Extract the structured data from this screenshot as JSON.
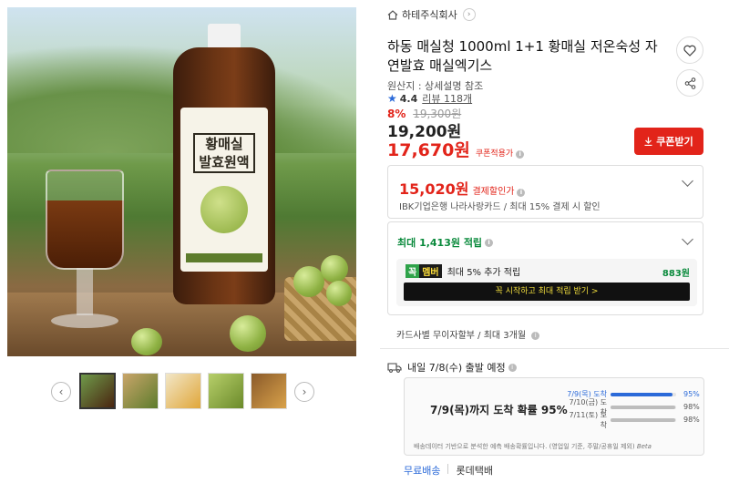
{
  "seller": {
    "name": "하테주식회사"
  },
  "product": {
    "title": "하동 매실청 1000ml 1+1 황매실 저온숙성 자연발효 매실엑기스",
    "origin": "원산지 : 상세설명 참조",
    "rating": "4.4",
    "reviews": "리뷰 118개",
    "discount_rate": "8%",
    "original_price": "19,300원",
    "price": "19,200원",
    "coupon_price": "17,670원",
    "coupon_price_tag": "쿠폰적용가",
    "coupon_button": "쿠폰받기"
  },
  "payment_discount": {
    "amount": "15,020원",
    "label": "결제할인가",
    "desc": "IBK기업은행 나라사랑카드 / 최대 15% 결제 시 할인"
  },
  "points": {
    "label": "최대 1,413원 적립",
    "member_badge_1": "꼭",
    "member_badge_2": "멤버",
    "member_text": "최대 5% 추가 적립",
    "member_points": "883원",
    "member_button": "꼭 시작하고 최대 적립 받기  >"
  },
  "card_installment": "카드사별 무이자할부 / 최대 3개월",
  "delivery": {
    "schedule": "내일 7/8(수) 출발 예정",
    "headline": "7/9(목)까지 도착 확률 95%",
    "rows": [
      {
        "date": "7/9(목) 도착",
        "percent": "95%",
        "value": 0.95
      },
      {
        "date": "7/10(금) 도착",
        "percent": "98%",
        "value": 0.98
      },
      {
        "date": "7/11(토) 도착",
        "percent": "98%",
        "value": 0.98
      }
    ],
    "note": "배송데이터 기반으로 분석한 예측 배송확률입니다. (영업일 기준, 주말/공휴일 제외)",
    "beta": "Beta",
    "free_shipping": "무료배송",
    "carrier": "롯데택배"
  },
  "bottle_label": {
    "line1": "황매실",
    "line2": "발효원액"
  },
  "icons": [
    "home-icon",
    "heart-icon",
    "share-icon",
    "chevron-left-icon",
    "chevron-right-icon",
    "truck-icon",
    "chevron-down-icon",
    "info-icon",
    "download-icon",
    "star-icon"
  ],
  "colors": {
    "accent_red": "#e2241a",
    "accent_green": "#0a8a3c",
    "accent_blue": "#2b6ad9"
  }
}
